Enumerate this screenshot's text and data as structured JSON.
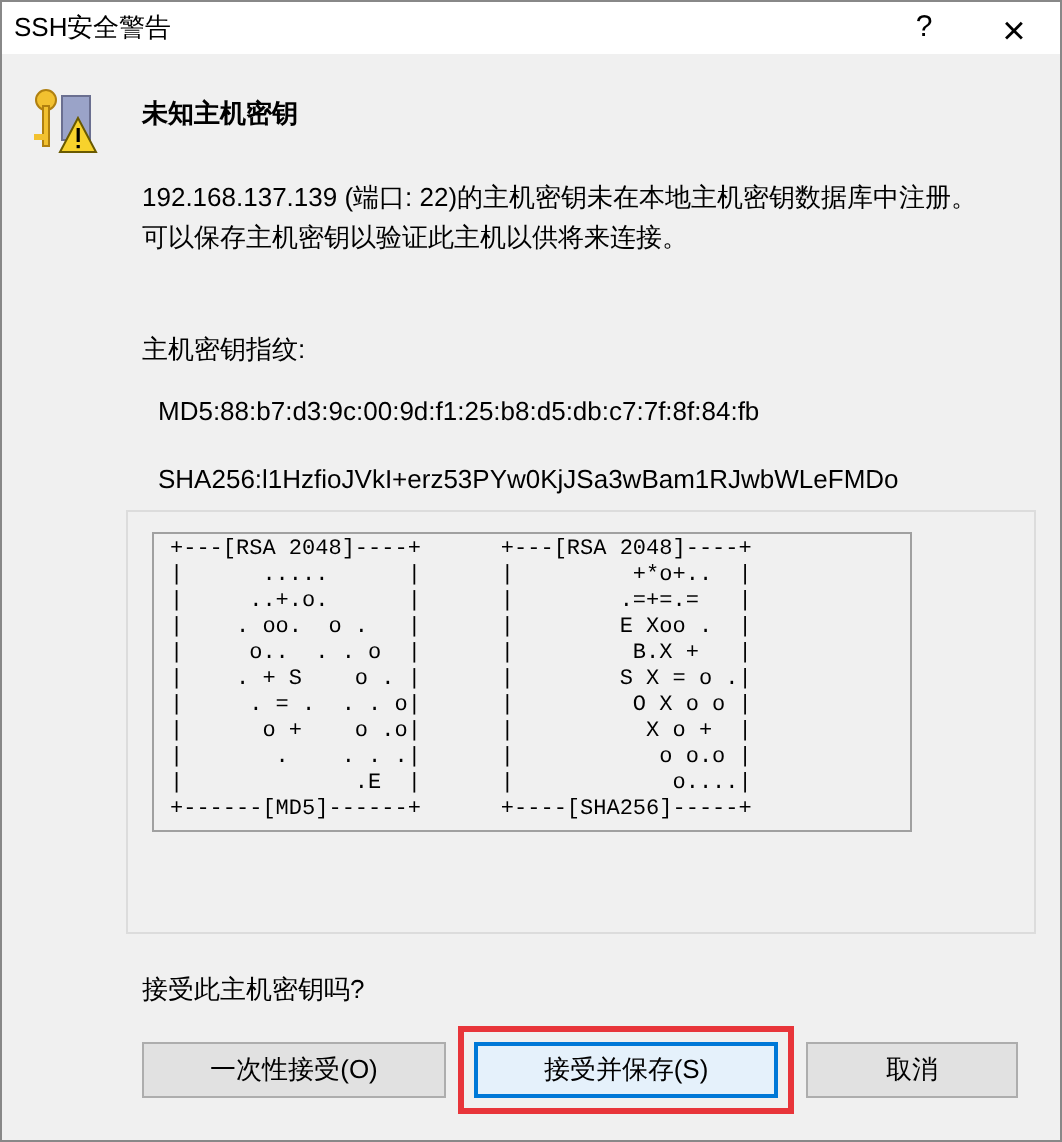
{
  "window": {
    "title": "SSH安全警告",
    "help_button": "?",
    "close_button": "×"
  },
  "heading": "未知主机密钥",
  "message": "192.168.137.139 (端口: 22)的主机密钥未在本地主机密钥数据库中注册。可以保存主机密钥以验证此主机以供将来连接。",
  "fingerprint_label": "主机密钥指纹:",
  "fingerprints": [
    "MD5:88:b7:d3:9c:00:9d:f1:25:b8:d5:db:c7:7f:8f:84:fb",
    "SHA256:l1HzfioJVkI+erz53PYw0KjJSa3wBam1RJwbWLeFMDo"
  ],
  "randomart": [
    {
      "lines": [
        "+---[RSA 2048]----+",
        "|      .....      |",
        "|     ..+.o.      |",
        "|    . oo.  o .   |",
        "|     o..  . . o  |",
        "|    . + S    o . |",
        "|     . = .  . . o|",
        "|      o +    o .o|",
        "|       .    . . .|",
        "|             .E  |",
        "+------[MD5]------+"
      ]
    },
    {
      "lines": [
        "+---[RSA 2048]----+",
        "|         +*o+..  |",
        "|        .=+=.=   |",
        "|        E Xoo .  |",
        "|         B.X +   |",
        "|        S X = o .|",
        "|         O X o o |",
        "|          X o +  |",
        "|           o o.o |",
        "|            o....|",
        "+----[SHA256]-----+"
      ]
    }
  ],
  "question": "接受此主机密钥吗?",
  "buttons": [
    {
      "label": "一次性接受(O)",
      "default": false,
      "highlighted": false
    },
    {
      "label": "接受并保存(S)",
      "default": true,
      "highlighted": true
    },
    {
      "label": "取消",
      "default": false,
      "highlighted": false
    }
  ]
}
